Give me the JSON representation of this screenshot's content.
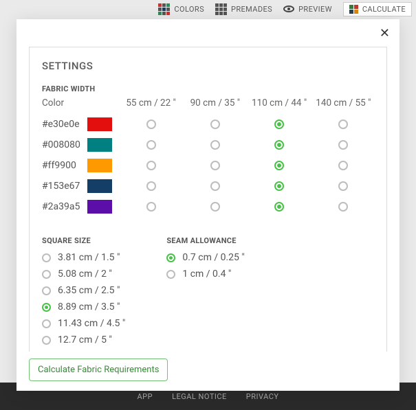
{
  "topbar": {
    "colors": "COLORS",
    "premades": "PREMADES",
    "preview": "PREVIEW",
    "calculate": "CALCULATE"
  },
  "footer": {
    "app": "APP",
    "legal": "LEGAL NOTICE",
    "privacy": "PRIVACY"
  },
  "modal": {
    "title": "SETTINGS",
    "fabric_width": {
      "label": "FABRIC WIDTH",
      "color_header": "Color",
      "widths": [
        "55 cm / 22 \"",
        "90 cm / 35 \"",
        "110 cm / 44 \"",
        "140 cm / 55 \""
      ],
      "rows": [
        {
          "hex": "#e30e0e",
          "swatch": "#e30e0e",
          "selected_index": 2
        },
        {
          "hex": "#008080",
          "swatch": "#008080",
          "selected_index": 2
        },
        {
          "hex": "#ff9900",
          "swatch": "#ff9900",
          "selected_index": 2
        },
        {
          "hex": "#153e67",
          "swatch": "#153e67",
          "selected_index": 2
        },
        {
          "hex": "#2a39a5",
          "swatch": "#5b0fa8",
          "selected_index": 2
        }
      ]
    },
    "square_size": {
      "label": "SQUARE SIZE",
      "options": [
        "3.81 cm / 1.5 \"",
        "5.08 cm / 2 \"",
        "6.35 cm / 2.5 \"",
        "8.89 cm / 3.5 \"",
        "11.43 cm / 4.5 \"",
        "12.7 cm / 5 \""
      ],
      "selected_index": 3
    },
    "seam_allowance": {
      "label": "SEAM ALLOWANCE",
      "options": [
        "0.7 cm / 0.25 \"",
        "1 cm / 0.4 \""
      ],
      "selected_index": 0
    },
    "button": "Calculate Fabric Requirements"
  }
}
